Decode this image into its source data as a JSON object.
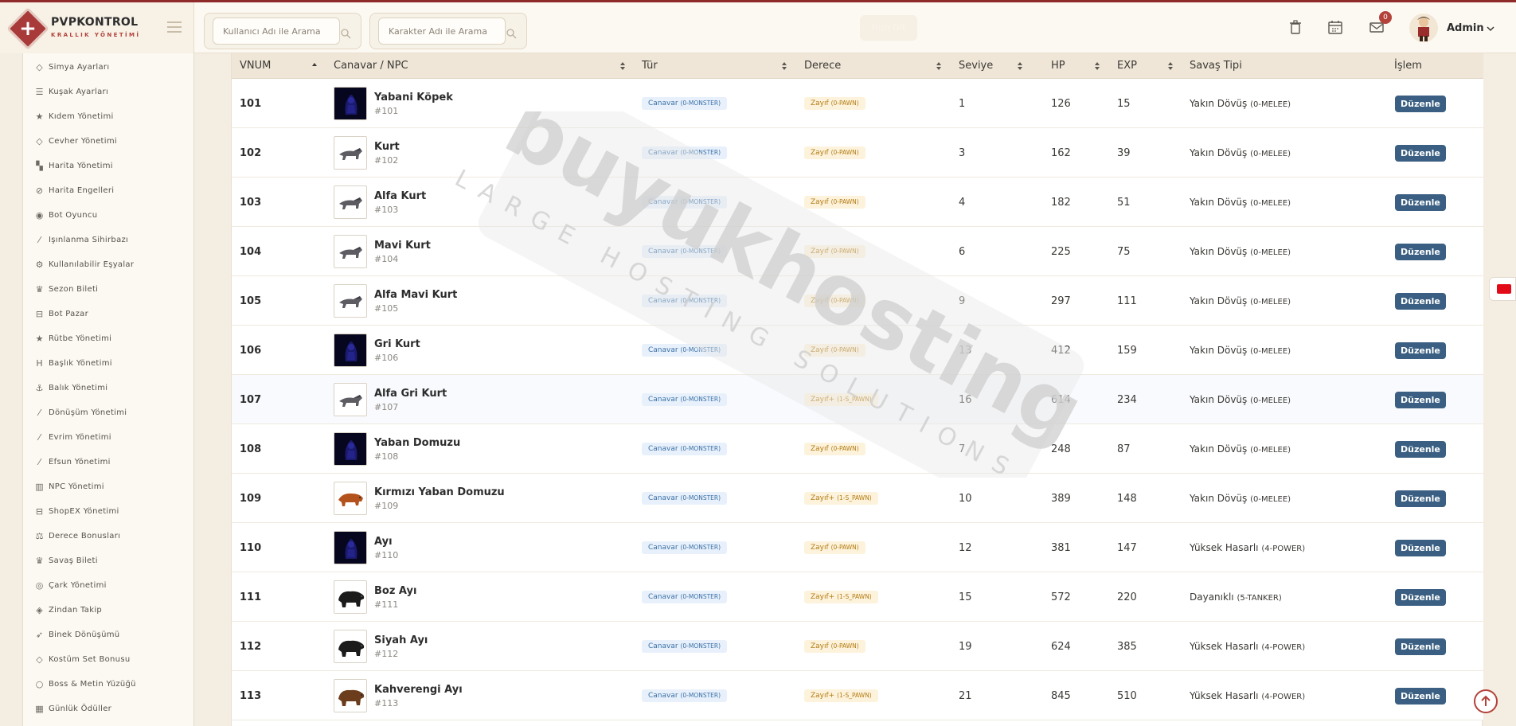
{
  "brand": {
    "title": "PVPKONTROL",
    "subtitle": "KRALLIK YÖNETİMİ"
  },
  "header": {
    "search_user_placeholder": "Kullanıcı Adı ile Arama",
    "search_char_placeholder": "Karakter Adı ile Arama",
    "ghost_button": "Hızlı Git",
    "notification_count": "0",
    "admin_name": "Admin"
  },
  "sidebar": {
    "items": [
      {
        "label": "Simya Ayarları",
        "icon": "diamond-icon"
      },
      {
        "label": "Kuşak Ayarları",
        "icon": "sliders-icon"
      },
      {
        "label": "Kıdem Yönetimi",
        "icon": "star-icon"
      },
      {
        "label": "Cevher Yönetimi",
        "icon": "diamond-icon"
      },
      {
        "label": "Harita Yönetimi",
        "icon": "map-icon"
      },
      {
        "label": "Harita Engelleri",
        "icon": "ban-icon"
      },
      {
        "label": "Bot Oyuncu",
        "icon": "android-icon"
      },
      {
        "label": "Işınlanma Sihirbazı",
        "icon": "magic-wand-icon"
      },
      {
        "label": "Kullanılabilir Eşyalar",
        "icon": "cogs-icon"
      },
      {
        "label": "Sezon Bileti",
        "icon": "trophy-icon"
      },
      {
        "label": "Bot Pazar",
        "icon": "cart-icon"
      },
      {
        "label": "Rütbe Yönetimi",
        "icon": "star-icon"
      },
      {
        "label": "Başlık Yönetimi",
        "icon": "heading-icon"
      },
      {
        "label": "Balık Yönetimi",
        "icon": "anchor-icon"
      },
      {
        "label": "Dönüşüm Yönetimi",
        "icon": "magic-wand-icon"
      },
      {
        "label": "Evrim Yönetimi",
        "icon": "magic-wand-icon"
      },
      {
        "label": "Efsun Yönetimi",
        "icon": "magic-wand-icon"
      },
      {
        "label": "NPC Yönetimi",
        "icon": "bank-icon"
      },
      {
        "label": "ShopEX Yönetimi",
        "icon": "cart-icon"
      },
      {
        "label": "Derece Bonusları",
        "icon": "balance-scale-icon"
      },
      {
        "label": "Savaş Bileti",
        "icon": "trophy-icon"
      },
      {
        "label": "Çark Yönetimi",
        "icon": "globe-icon"
      },
      {
        "label": "Zindan Takip",
        "icon": "map-marker-icon"
      },
      {
        "label": "Binek Dönüşümü",
        "icon": "rocket-icon"
      },
      {
        "label": "Kostüm Set Bonusu",
        "icon": "diamond-icon"
      },
      {
        "label": "Boss & Metin Yüzüğü",
        "icon": "circle-icon"
      },
      {
        "label": "Günlük Ödüller",
        "icon": "calendar-icon"
      }
    ]
  },
  "table": {
    "headers": [
      "VNUM",
      "Canavar / NPC",
      "Tür",
      "Derece",
      "Seviye",
      "HP",
      "EXP",
      "Savaş Tipi",
      "İşlem"
    ],
    "edit_label": "Düzenle",
    "rows": [
      {
        "vnum": "101",
        "name": "Yabani Köpek",
        "id": "#101",
        "type": "Canavar",
        "type_code": "(0-MONSTER)",
        "rank": "Zayıf",
        "rank_code": "(0-PAWN)",
        "level": "1",
        "hp": "126",
        "exp": "15",
        "battle": "Yakın Dövüş",
        "battle_code": "(0-MELEE)",
        "sprite": "dark"
      },
      {
        "vnum": "102",
        "name": "Kurt",
        "id": "#102",
        "type": "Canavar",
        "type_code": "(0-MONSTER)",
        "rank": "Zayıf",
        "rank_code": "(0-PAWN)",
        "level": "3",
        "hp": "162",
        "exp": "39",
        "battle": "Yakın Dövüş",
        "battle_code": "(0-MELEE)",
        "sprite": "wolf"
      },
      {
        "vnum": "103",
        "name": "Alfa Kurt",
        "id": "#103",
        "type": "Canavar",
        "type_code": "(0-MONSTER)",
        "rank": "Zayıf",
        "rank_code": "(0-PAWN)",
        "level": "4",
        "hp": "182",
        "exp": "51",
        "battle": "Yakın Dövüş",
        "battle_code": "(0-MELEE)",
        "sprite": "wolf"
      },
      {
        "vnum": "104",
        "name": "Mavi Kurt",
        "id": "#104",
        "type": "Canavar",
        "type_code": "(0-MONSTER)",
        "rank": "Zayıf",
        "rank_code": "(0-PAWN)",
        "level": "6",
        "hp": "225",
        "exp": "75",
        "battle": "Yakın Dövüş",
        "battle_code": "(0-MELEE)",
        "sprite": "wolf"
      },
      {
        "vnum": "105",
        "name": "Alfa Mavi Kurt",
        "id": "#105",
        "type": "Canavar",
        "type_code": "(0-MONSTER)",
        "rank": "Zayıf",
        "rank_code": "(0-PAWN)",
        "level": "9",
        "hp": "297",
        "exp": "111",
        "battle": "Yakın Dövüş",
        "battle_code": "(0-MELEE)",
        "sprite": "wolf"
      },
      {
        "vnum": "106",
        "name": "Gri Kurt",
        "id": "#106",
        "type": "Canavar",
        "type_code": "(0-MONSTER)",
        "rank": "Zayıf",
        "rank_code": "(0-PAWN)",
        "level": "13",
        "hp": "412",
        "exp": "159",
        "battle": "Yakın Dövüş",
        "battle_code": "(0-MELEE)",
        "sprite": "dark"
      },
      {
        "vnum": "107",
        "name": "Alfa Gri Kurt",
        "id": "#107",
        "type": "Canavar",
        "type_code": "(0-MONSTER)",
        "rank": "Zayıf+",
        "rank_code": "(1-S_PAWN)",
        "level": "16",
        "hp": "614",
        "exp": "234",
        "battle": "Yakın Dövüş",
        "battle_code": "(0-MELEE)",
        "sprite": "wolf"
      },
      {
        "vnum": "108",
        "name": "Yaban Domuzu",
        "id": "#108",
        "type": "Canavar",
        "type_code": "(0-MONSTER)",
        "rank": "Zayıf",
        "rank_code": "(0-PAWN)",
        "level": "7",
        "hp": "248",
        "exp": "87",
        "battle": "Yakın Dövüş",
        "battle_code": "(0-MELEE)",
        "sprite": "dark"
      },
      {
        "vnum": "109",
        "name": "Kırmızı Yaban Domuzu",
        "id": "#109",
        "type": "Canavar",
        "type_code": "(0-MONSTER)",
        "rank": "Zayıf+",
        "rank_code": "(1-S_PAWN)",
        "level": "10",
        "hp": "389",
        "exp": "148",
        "battle": "Yakın Dövüş",
        "battle_code": "(0-MELEE)",
        "sprite": "boar"
      },
      {
        "vnum": "110",
        "name": "Ayı",
        "id": "#110",
        "type": "Canavar",
        "type_code": "(0-MONSTER)",
        "rank": "Zayıf",
        "rank_code": "(0-PAWN)",
        "level": "12",
        "hp": "381",
        "exp": "147",
        "battle": "Yüksek Hasarlı",
        "battle_code": "(4-POWER)",
        "sprite": "dark"
      },
      {
        "vnum": "111",
        "name": "Boz Ayı",
        "id": "#111",
        "type": "Canavar",
        "type_code": "(0-MONSTER)",
        "rank": "Zayıf+",
        "rank_code": "(1-S_PAWN)",
        "level": "15",
        "hp": "572",
        "exp": "220",
        "battle": "Dayanıklı",
        "battle_code": "(5-TANKER)",
        "sprite": "bear"
      },
      {
        "vnum": "112",
        "name": "Siyah Ayı",
        "id": "#112",
        "type": "Canavar",
        "type_code": "(0-MONSTER)",
        "rank": "Zayıf",
        "rank_code": "(0-PAWN)",
        "level": "19",
        "hp": "624",
        "exp": "385",
        "battle": "Yüksek Hasarlı",
        "battle_code": "(4-POWER)",
        "sprite": "bear"
      },
      {
        "vnum": "113",
        "name": "Kahverengi Ayı",
        "id": "#113",
        "type": "Canavar",
        "type_code": "(0-MONSTER)",
        "rank": "Zayıf+",
        "rank_code": "(1-S_PAWN)",
        "level": "21",
        "hp": "845",
        "exp": "510",
        "battle": "Yüksek Hasarlı",
        "battle_code": "(4-POWER)",
        "sprite": "brownbear"
      }
    ]
  },
  "watermark": {
    "brand": "buyukhosting",
    "tagline": "LARGE HOSTING SOLUTIONS"
  }
}
